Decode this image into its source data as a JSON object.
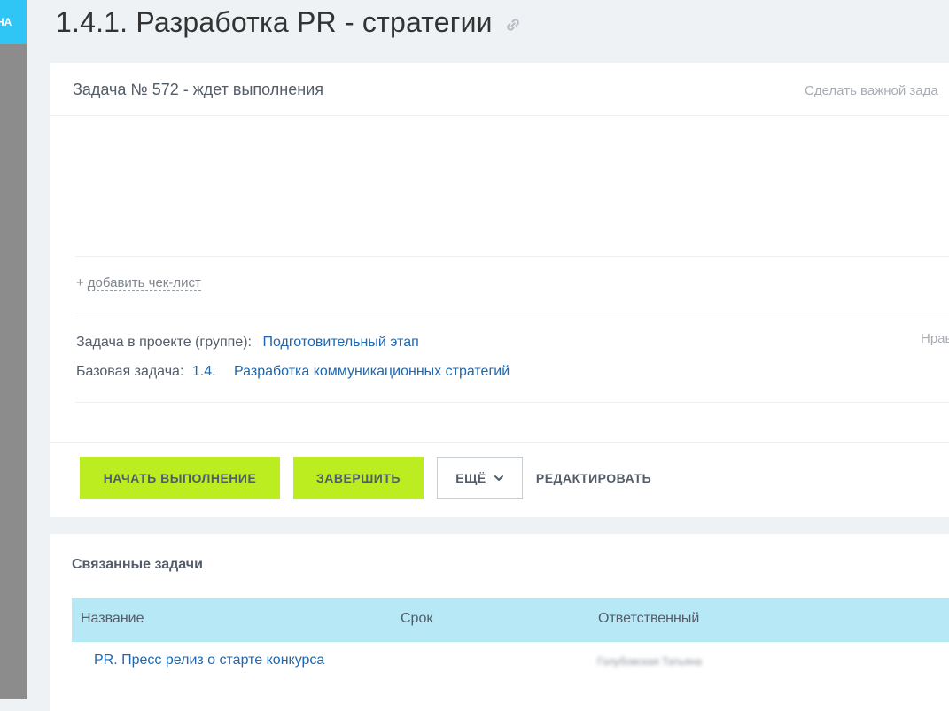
{
  "sidebar": {
    "tab_label": "НА"
  },
  "header": {
    "title": "1.4.1. Разработка PR - стратегии"
  },
  "task": {
    "status_line": "Задача № 572 - ждет выполнения",
    "make_important": "Сделать важной зада",
    "checklist_plus": "+",
    "checklist_link": "добавить чек-лист",
    "project_label": "Задача в проекте (группе):",
    "project_value": "Подготовительный этап",
    "base_label": "Базовая задача:",
    "base_number": "1.4.",
    "base_value": "Разработка коммуникационных стратегий",
    "right_cut": "Нрав"
  },
  "actions": {
    "start": "НАЧАТЬ ВЫПОЛНЕНИЕ",
    "finish": "ЗАВЕРШИТЬ",
    "more": "ЕЩЁ",
    "edit": "РЕДАКТИРОВАТЬ"
  },
  "related": {
    "title": "Связанные задачи",
    "columns": [
      "Название",
      "Срок",
      "Ответственный"
    ],
    "rows": [
      {
        "name": "PR. Пресс релиз о старте конкурса",
        "deadline": "",
        "responsible": "Голубовская Татьяна"
      }
    ]
  },
  "colors": {
    "accent_green": "#bbed21",
    "link_blue": "#2067b0",
    "table_header": "#b7e8f6",
    "left_tab": "#2fc6f6"
  }
}
